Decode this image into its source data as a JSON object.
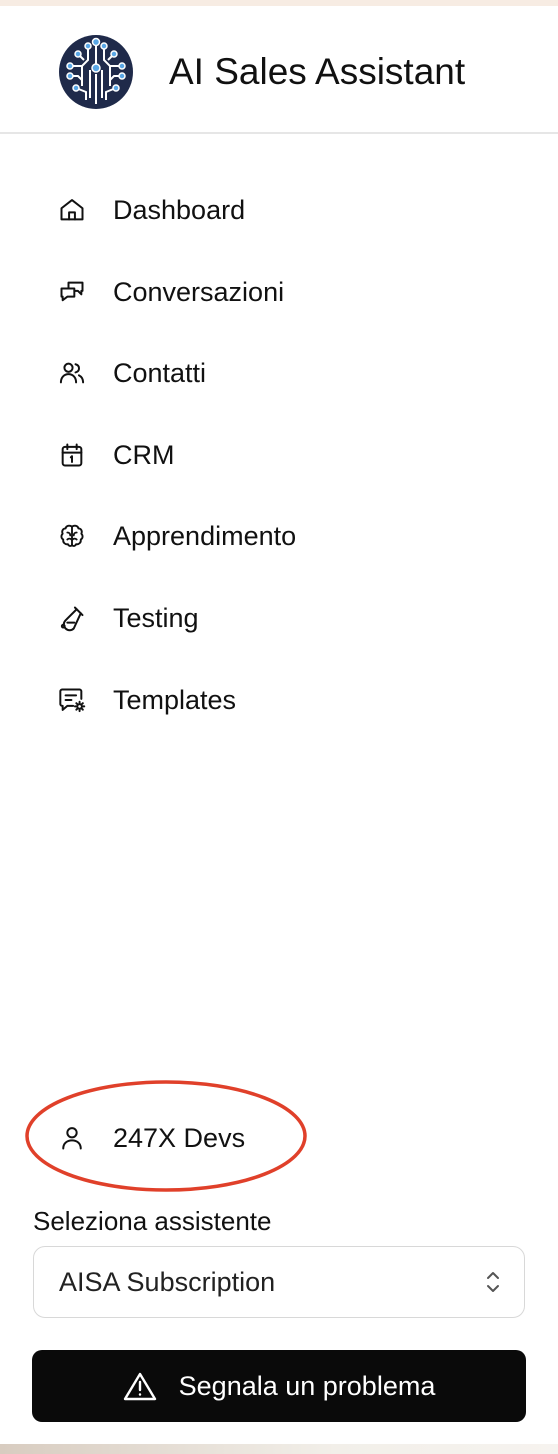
{
  "app": {
    "title": "AI Sales Assistant",
    "logo_icon": "circuit-brain-logo"
  },
  "nav": {
    "items": [
      {
        "label": "Dashboard",
        "icon": "home-icon"
      },
      {
        "label": "Conversazioni",
        "icon": "chat-bubbles-icon"
      },
      {
        "label": "Contatti",
        "icon": "users-icon"
      },
      {
        "label": "CRM",
        "icon": "calendar-icon"
      },
      {
        "label": "Apprendimento",
        "icon": "brain-icon"
      },
      {
        "label": "Testing",
        "icon": "test-tube-icon"
      },
      {
        "label": "Templates",
        "icon": "message-settings-icon"
      }
    ]
  },
  "user": {
    "name": "247X Devs",
    "icon": "user-icon"
  },
  "assistant_select": {
    "label": "Seleziona assistente",
    "value": "AISA Subscription"
  },
  "report_button": {
    "label": "Segnala un problema",
    "icon": "warning-icon"
  },
  "colors": {
    "annotation": "#e0402a",
    "button_bg": "#0a0a0a",
    "logo_navy": "#1f2a4a",
    "logo_accent": "#5aa7e6"
  }
}
